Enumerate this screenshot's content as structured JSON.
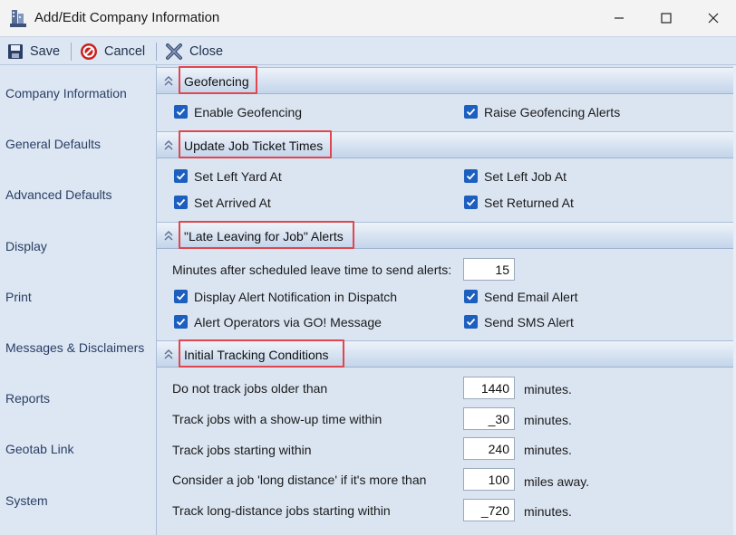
{
  "window": {
    "title": "Add/Edit Company Information"
  },
  "toolbar": {
    "save": "Save",
    "cancel": "Cancel",
    "close": "Close"
  },
  "sidebar": {
    "items": [
      "Company Information",
      "General Defaults",
      "Advanced Defaults",
      "Display",
      "Print",
      "Messages & Disclaimers",
      "Reports",
      "Geotab Link",
      "System"
    ]
  },
  "geofencing": {
    "title": "Geofencing",
    "enable": {
      "label": "Enable Geofencing",
      "checked": true
    },
    "raise": {
      "label": "Raise Geofencing Alerts",
      "checked": true
    }
  },
  "ticket_times": {
    "title": "Update Job Ticket Times",
    "left_yard": {
      "label": "Set Left Yard At",
      "checked": true
    },
    "left_job": {
      "label": "Set Left Job At",
      "checked": true
    },
    "arrived": {
      "label": "Set Arrived At",
      "checked": true
    },
    "returned": {
      "label": "Set Returned At",
      "checked": true
    }
  },
  "late_alerts": {
    "title": "\"Late Leaving for Job\" Alerts",
    "minutes_label": "Minutes after scheduled leave time to send alerts:",
    "minutes_value": "15",
    "dispatch": {
      "label": "Display Alert Notification in Dispatch",
      "checked": true
    },
    "email": {
      "label": "Send Email Alert",
      "checked": true
    },
    "go_message": {
      "label": "Alert Operators via GO! Message",
      "checked": true
    },
    "sms": {
      "label": "Send SMS Alert",
      "checked": true
    }
  },
  "tracking": {
    "title": "Initial Tracking Conditions",
    "rows": [
      {
        "label": "Do not track jobs older than",
        "value": "1440",
        "unit": "minutes."
      },
      {
        "label": "Track jobs with a show-up time within",
        "value": "_30",
        "unit": "minutes."
      },
      {
        "label": "Track jobs starting within",
        "value": "240",
        "unit": "minutes."
      },
      {
        "label": "Consider a job 'long distance' if it's more than",
        "value": "100",
        "unit": "miles away."
      },
      {
        "label": "Track long-distance jobs starting within",
        "value": "_720",
        "unit": "minutes."
      }
    ]
  },
  "colors": {
    "accent": "#1d5fbf",
    "highlight": "#e0464d",
    "panel": "#dbe5f2"
  }
}
